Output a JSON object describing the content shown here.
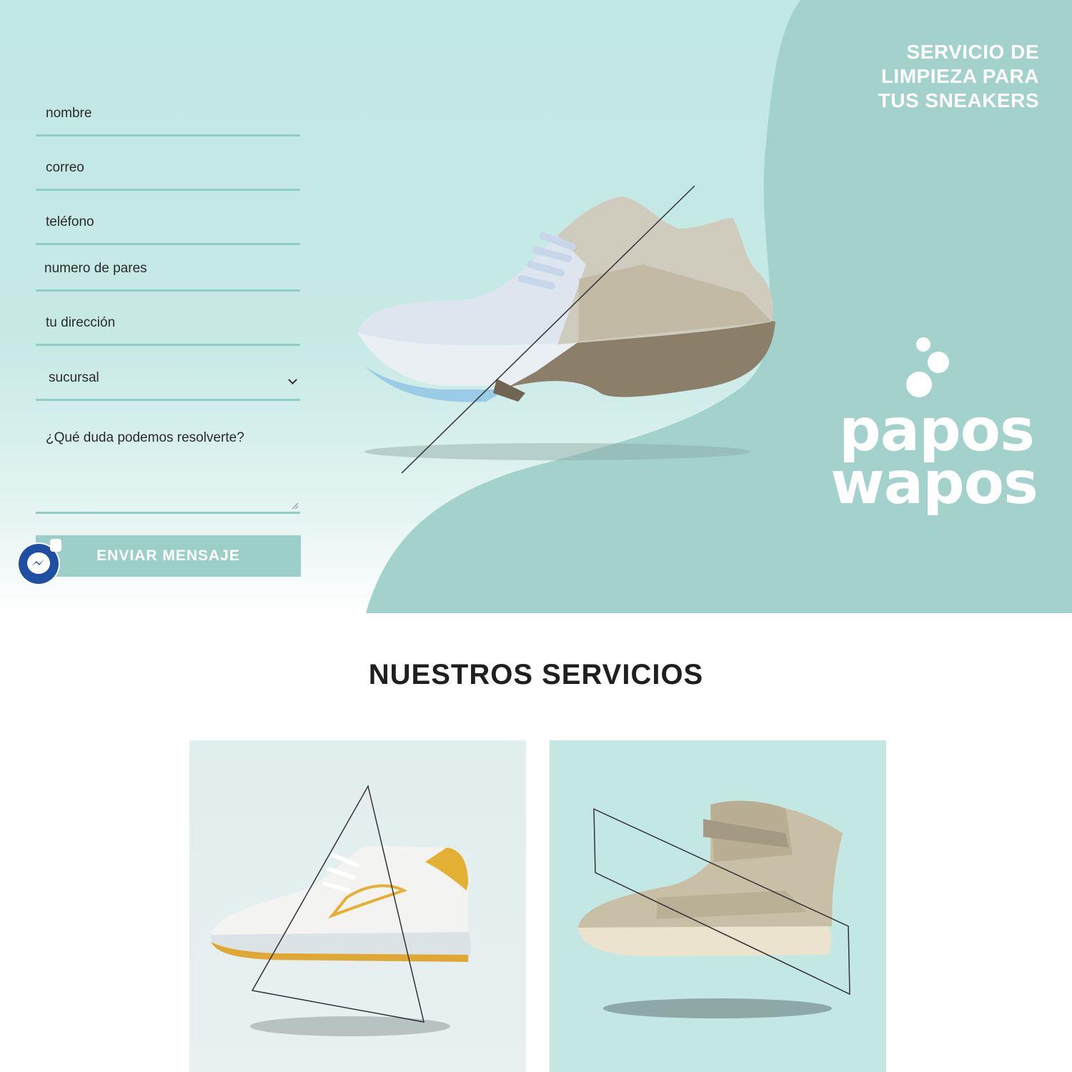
{
  "hero": {
    "title_lines": [
      "SERVICIO DE",
      "LIMPIEZA PARA",
      "TUS SNEAKERS"
    ]
  },
  "form": {
    "fields": [
      {
        "label": "nombre"
      },
      {
        "label": "correo"
      },
      {
        "label": "teléfono"
      },
      {
        "label": "numero de pares"
      },
      {
        "label": "tu dirección"
      },
      {
        "label": "sucursal"
      },
      {
        "label": "¿Qué duda podemos resolverte?"
      }
    ],
    "submit_label": "ENVIAR MENSAJE"
  },
  "logo": {
    "line1": "papos",
    "line2": "wapos"
  },
  "services": {
    "title": "NUESTROS SERVICIOS"
  },
  "colors": {
    "hero_bg": "#c4e9e4",
    "blob": "#a2d2cb",
    "field_line": "#8fcdc5",
    "button": "#9bcfc8",
    "messenger": "#1f4fa3"
  }
}
